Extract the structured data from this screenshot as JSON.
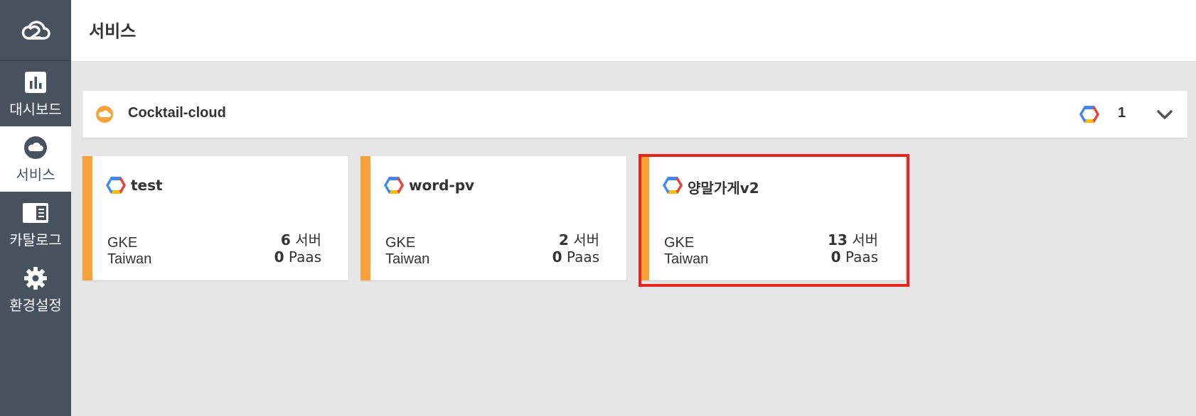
{
  "header": {
    "title": "서비스"
  },
  "sidebar": {
    "items": [
      {
        "label": "대시보드",
        "icon": "bar-chart-icon"
      },
      {
        "label": "서비스",
        "icon": "cloud-icon",
        "active": true
      },
      {
        "label": "카탈로그",
        "icon": "catalog-icon"
      },
      {
        "label": "환경설정",
        "icon": "gear-icon"
      }
    ]
  },
  "provider": {
    "name": "Cocktail-cloud",
    "count": "1"
  },
  "cards": [
    {
      "name": "test",
      "type": "GKE",
      "region": "Taiwan",
      "servers_count": "6",
      "servers_label": "서버",
      "paas_count": "0",
      "paas_label": "Paas"
    },
    {
      "name": "word-pv",
      "type": "GKE",
      "region": "Taiwan",
      "servers_count": "2",
      "servers_label": "서버",
      "paas_count": "0",
      "paas_label": "Paas"
    },
    {
      "name": "양말가게v2",
      "type": "GKE",
      "region": "Taiwan",
      "servers_count": "13",
      "servers_label": "서버",
      "paas_count": "0",
      "paas_label": "Paas"
    }
  ],
  "colors": {
    "sidebar_bg": "#48525f",
    "accent_orange": "#f7a239",
    "highlight_red": "#e8241f",
    "background": "#e6e6e6"
  }
}
